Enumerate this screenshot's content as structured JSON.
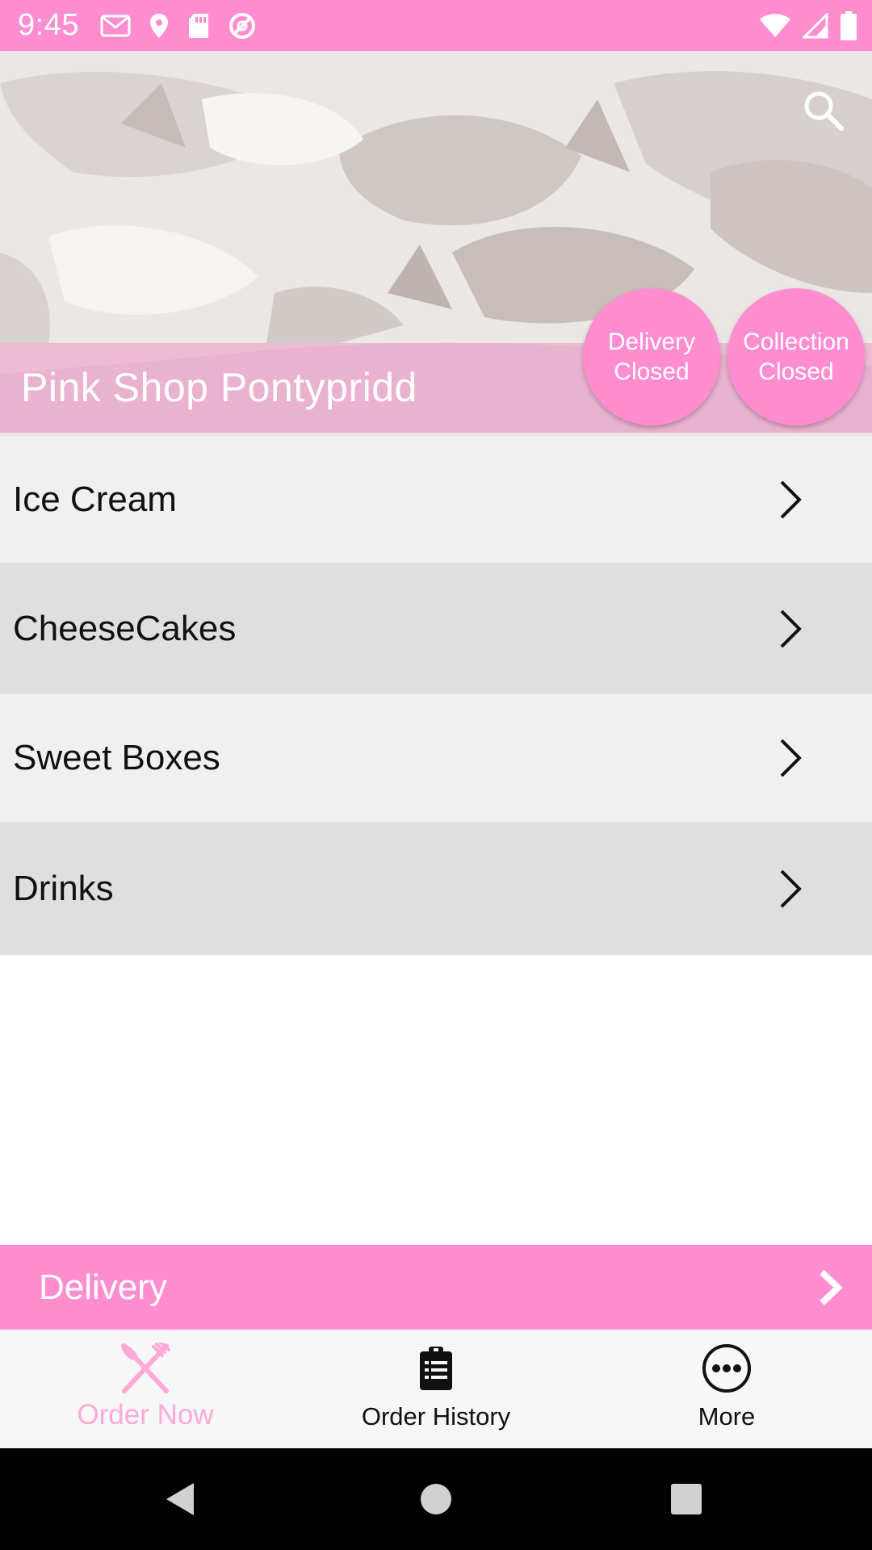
{
  "status_bar": {
    "time": "9:45",
    "left_icons": [
      "gmail-icon",
      "location-icon",
      "sd-card-icon",
      "data-saver-icon"
    ],
    "right_icons": [
      "wifi-icon",
      "signal-icon",
      "battery-icon"
    ]
  },
  "hero": {
    "shop_name": "Pink Shop Pontypridd",
    "search_icon": "search-icon",
    "delivery_status": {
      "line1": "Delivery",
      "line2": "Closed"
    },
    "collection_status": {
      "line1": "Collection",
      "line2": "Closed"
    }
  },
  "categories": [
    {
      "label": "Ice Cream"
    },
    {
      "label": "CheeseCakes"
    },
    {
      "label": "Sweet Boxes"
    },
    {
      "label": "Drinks"
    }
  ],
  "delivery_bar": {
    "label": "Delivery"
  },
  "bottom_nav": {
    "items": [
      {
        "label": "Order Now",
        "icon": "fork-knife-icon",
        "active": true
      },
      {
        "label": "Order History",
        "icon": "clipboard-list-icon",
        "active": false
      },
      {
        "label": "More",
        "icon": "more-dots-icon",
        "active": false
      }
    ]
  },
  "colors": {
    "accent": "#ff8dd0",
    "active_nav": "#ffa9d8",
    "row_light": "#f0f0f0",
    "row_dark": "#dfdfdf"
  }
}
